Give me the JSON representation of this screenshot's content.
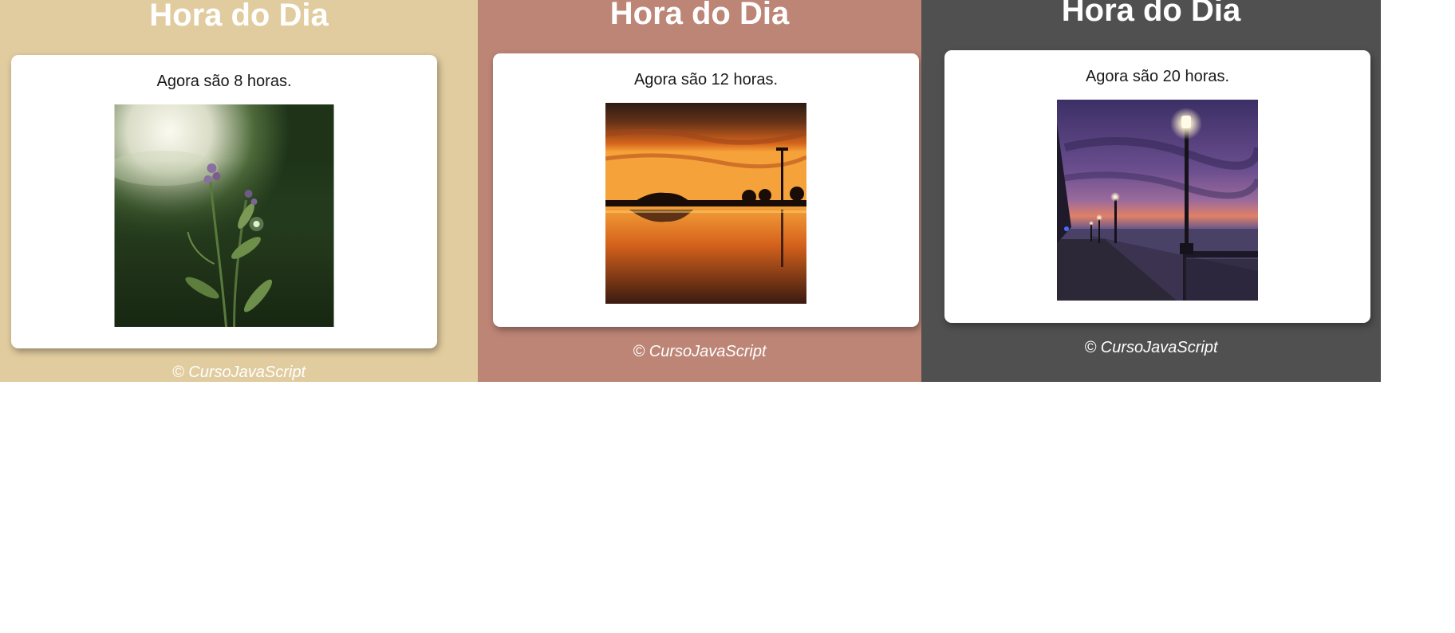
{
  "panels": [
    {
      "title": "Hora do Dia",
      "message": "Agora são 8 horas.",
      "image": "morning-plant-photo",
      "footer": "© CursoJavaScript",
      "background": "#e1cc9f"
    },
    {
      "title": "Hora do Dia",
      "message": "Agora são 12 horas.",
      "image": "sunset-reflection-photo",
      "footer": "© CursoJavaScript",
      "background": "#bd8576"
    },
    {
      "title": "Hora do Dia",
      "message": "Agora são 20 horas.",
      "image": "night-boardwalk-photo",
      "footer": "© CursoJavaScript",
      "background": "#505050"
    }
  ]
}
